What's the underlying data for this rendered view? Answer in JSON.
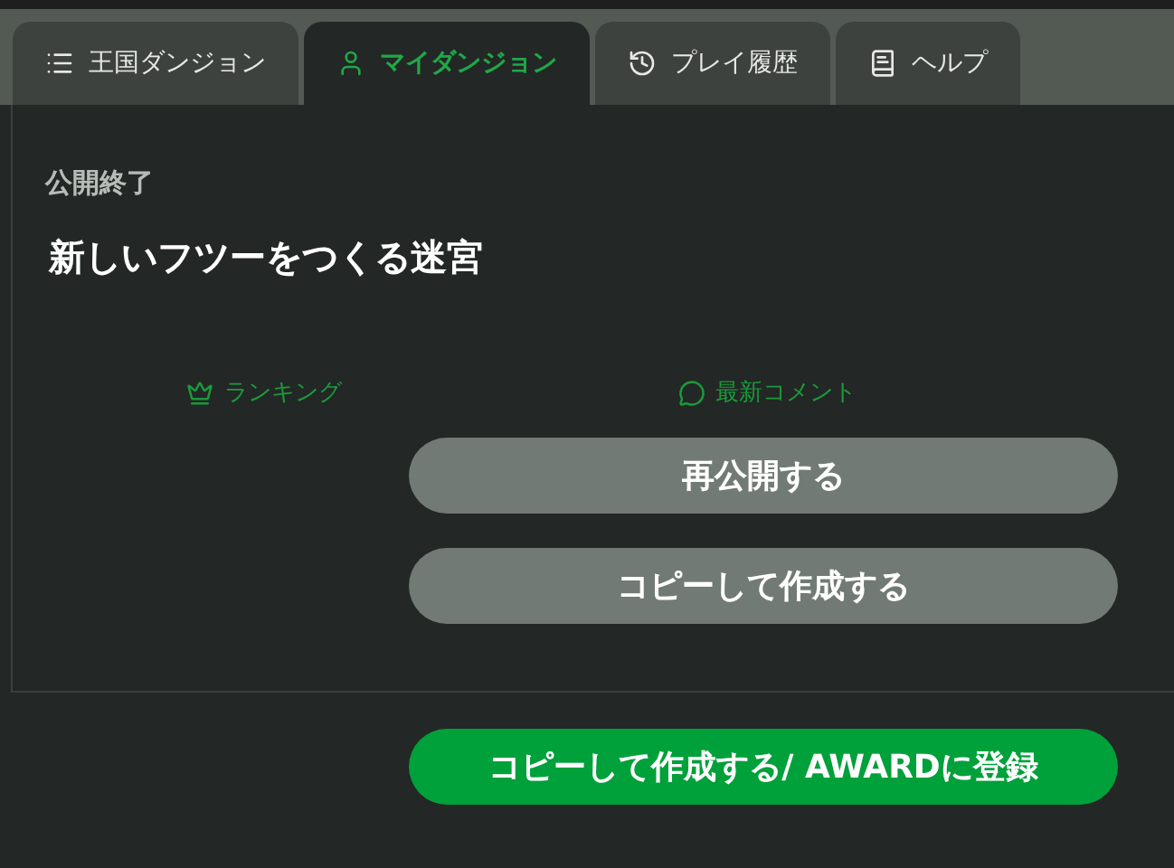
{
  "tabs": [
    {
      "label": "王国ダンジョン",
      "selected": false
    },
    {
      "label": "マイダンジョン",
      "selected": true
    },
    {
      "label": "プレイ履歴",
      "selected": false
    },
    {
      "label": "ヘルプ",
      "selected": false
    }
  ],
  "status": "公開終了",
  "title": "新しいフツーをつくる迷宮",
  "links": [
    {
      "label": "ランキング"
    },
    {
      "label": "最新コメント"
    }
  ],
  "buttons": [
    {
      "label": "再公開する",
      "kind": "secondary"
    },
    {
      "label": "コピーして作成する",
      "kind": "secondary"
    }
  ],
  "footer_button": {
    "label": "コピーして作成する/ AWARDに登録",
    "kind": "primary"
  }
}
